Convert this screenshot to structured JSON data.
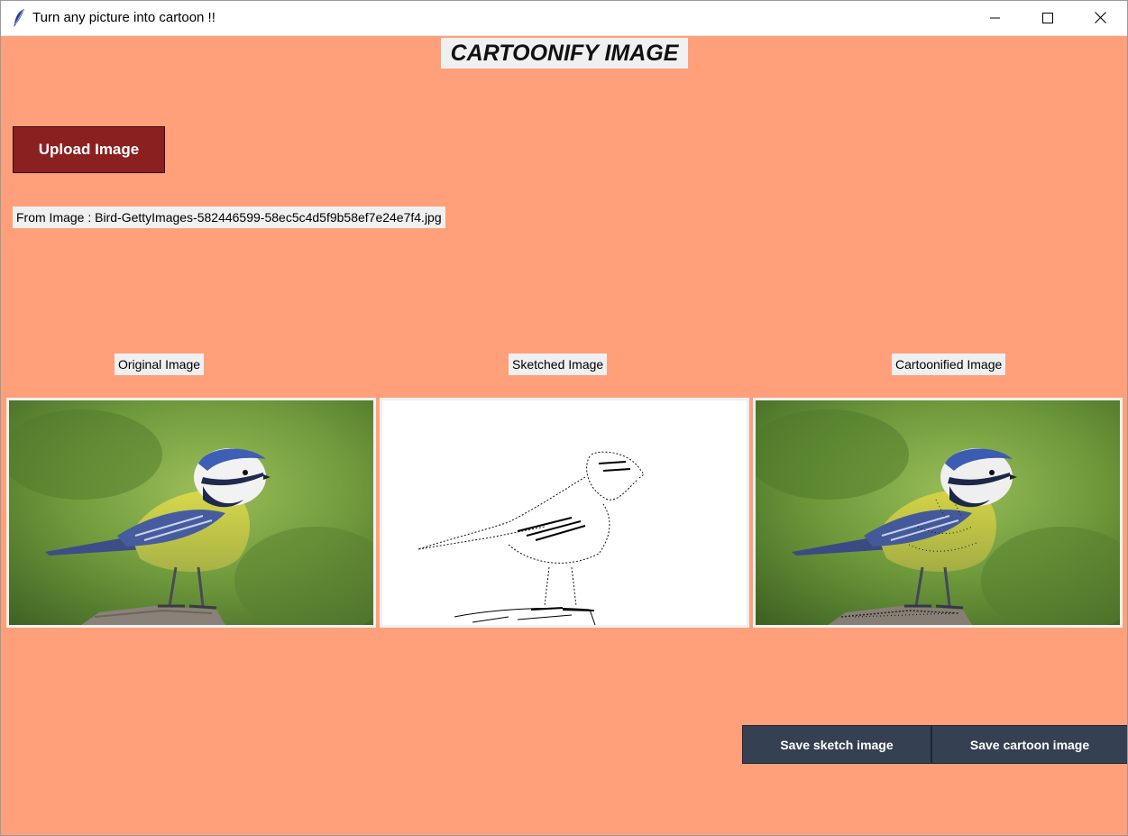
{
  "window": {
    "title": "Turn any picture into cartoon !!"
  },
  "heading": "CARTOONIFY IMAGE",
  "upload": {
    "label": "Upload Image"
  },
  "source": {
    "label": "From Image : Bird-GettyImages-582446599-58ec5c4d5f9b58ef7e24e7f4.jpg"
  },
  "panels": {
    "original_caption": "Original Image",
    "sketch_caption": "Sketched Image",
    "cartoon_caption": "Cartoonified Image"
  },
  "actions": {
    "save_sketch": "Save sketch image",
    "save_cartoon": "Save cartoon image"
  },
  "colors": {
    "background": "#ffa07a",
    "upload_button": "#8b2020",
    "save_buttons": "#354052",
    "label_bg": "#f0f0f0"
  },
  "icons": {
    "app": "feather-icon",
    "minimize": "minimize-icon",
    "maximize": "maximize-icon",
    "close": "close-icon"
  }
}
